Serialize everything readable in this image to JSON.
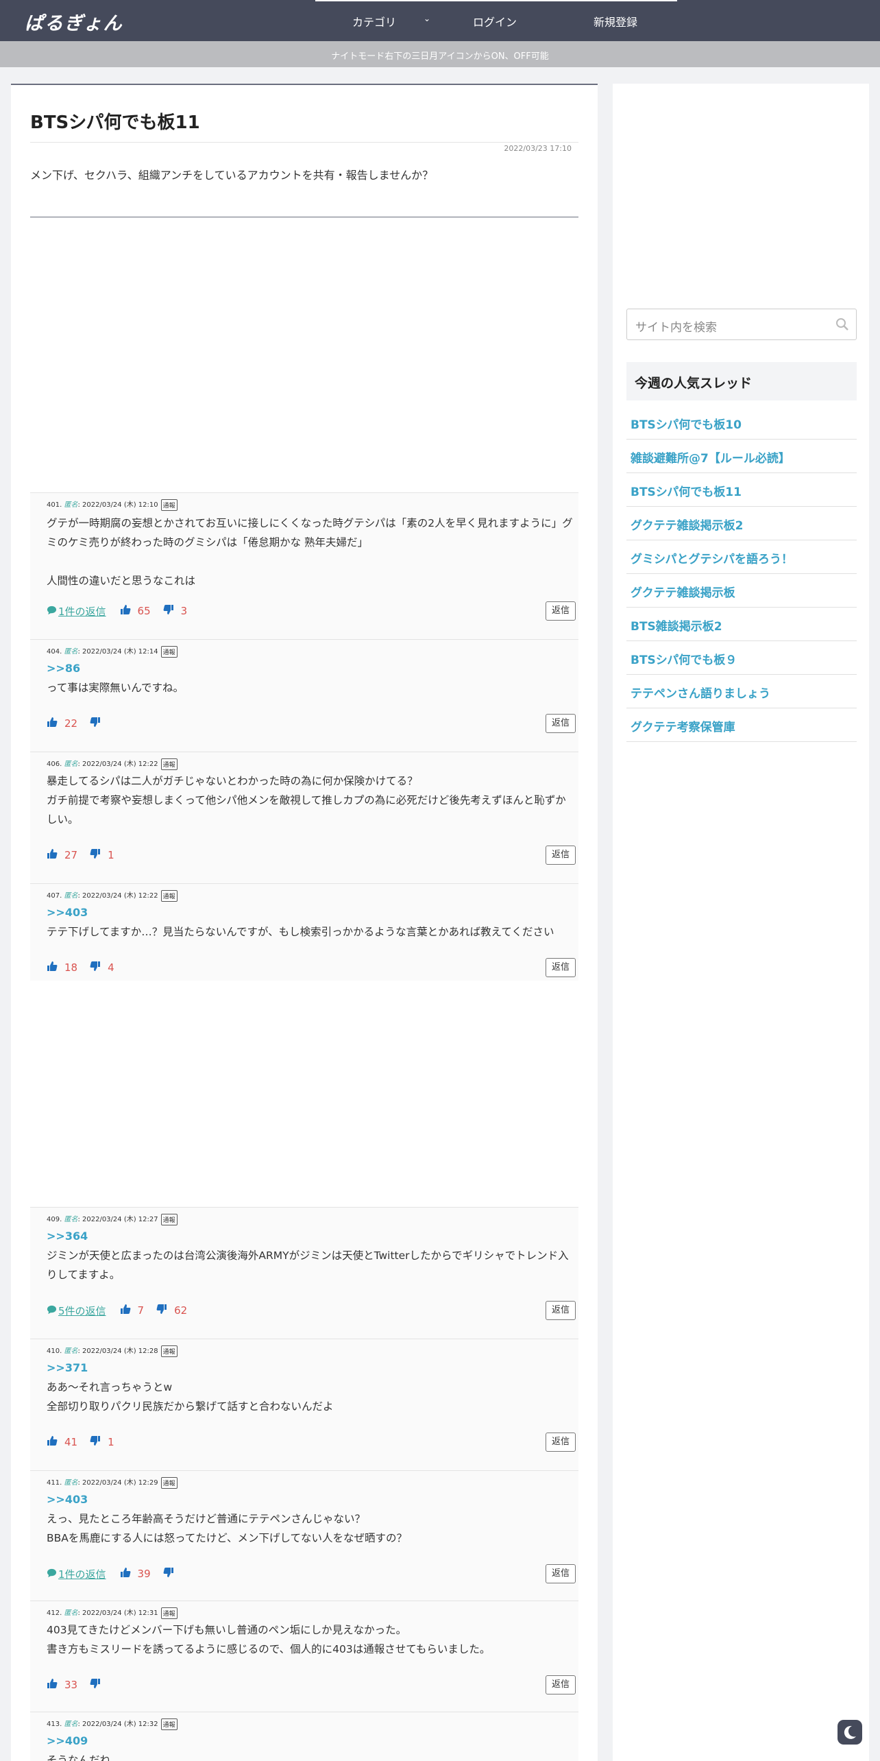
{
  "header": {
    "logo": "ぱるぎょん",
    "nav": {
      "category": "カテゴリ",
      "login": "ログイン",
      "register": "新規登録"
    }
  },
  "notice": "ナイトモード右下の三日月アイコンからON、OFF可能",
  "thread": {
    "title": "BTSシパ何でも板11",
    "date": "2022/03/23 17:10",
    "description": "メン下げ、セクハラ、組織アンチをしているアカウントを共有・報告しませんか？"
  },
  "labels": {
    "anon": "匿名",
    "report": "通報",
    "reply": "返信"
  },
  "posts": [
    {
      "num": "401.",
      "time": ": 2022/03/24 (木) 12:10",
      "ref": "",
      "body": [
        "グテが一時期腐の妄想とかされてお互いに接しにくくなった時グテシパは「素の2人を早く見れますように」グミのケミ売りが終わった時のグミシパは「倦怠期かな 熟年夫婦だ」",
        "",
        "人間性の違いだと思うなこれは"
      ],
      "replies": "1件の返信",
      "likes": "65",
      "dislikes": "3"
    },
    {
      "num": "404.",
      "time": ": 2022/03/24 (木) 12:14",
      "ref": ">>86",
      "body": [
        "って事は実際無いんですね。"
      ],
      "replies": "",
      "likes": "22",
      "dislikes": ""
    },
    {
      "num": "406.",
      "time": ": 2022/03/24 (木) 12:22",
      "ref": "",
      "body": [
        "暴走してるシパは二人がガチじゃないとわかった時の為に何か保険かけてる？",
        "ガチ前提で考察や妄想しまくって他シパ他メンを敵視して推しカプの為に必死だけど後先考えずほんと恥ずかしい。"
      ],
      "replies": "",
      "likes": "27",
      "dislikes": "1"
    },
    {
      "num": "407.",
      "time": ": 2022/03/24 (木) 12:22",
      "ref": ">>403",
      "body": [
        "テテ下げしてますか…？見当たらないんですが、もし検索引っかかるような言葉とかあれば教えてください"
      ],
      "replies": "",
      "likes": "18",
      "dislikes": "4"
    },
    {
      "num": "409.",
      "time": ": 2022/03/24 (木) 12:27",
      "ref": ">>364",
      "body": [
        "ジミンが天使と広まったのは台湾公演後海外ARMYがジミンは天使とTwitterしたからでギリシャでトレンド入りしてますよ。"
      ],
      "replies": "5件の返信",
      "likes": "7",
      "dislikes": "62"
    },
    {
      "num": "410.",
      "time": ": 2022/03/24 (木) 12:28",
      "ref": ">>371",
      "body": [
        "ああ〜それ言っちゃうとw",
        "全部切り取りパクリ民族だから繋げて話すと合わないんだよ"
      ],
      "replies": "",
      "likes": "41",
      "dislikes": "1"
    },
    {
      "num": "411.",
      "time": ": 2022/03/24 (木) 12:29",
      "ref": ">>403",
      "body": [
        "えっ、見たところ年齢高そうだけど普通にテテペンさんじゃない？",
        "BBAを馬鹿にする人には怒ってたけど、メン下げしてない人をなぜ晒すの？"
      ],
      "replies": "1件の返信",
      "likes": "39",
      "dislikes": ""
    },
    {
      "num": "412.",
      "time": ": 2022/03/24 (木) 12:31",
      "ref": "",
      "body": [
        "403見てきたけどメンバー下げも無いし普通のペン垢にしか見えなかった。",
        "書き方もミスリードを誘ってるように感じるので、個人的に403は通報させてもらいました。"
      ],
      "replies": "",
      "likes": "33",
      "dislikes": ""
    },
    {
      "num": "413.",
      "time": ": 2022/03/24 (木) 12:32",
      "ref": ">>409",
      "body": [
        "そうなんだね"
      ],
      "replies": "",
      "likes": "",
      "dislikes": ""
    }
  ],
  "sidebar": {
    "search_placeholder": "サイト内を検索",
    "popular_title": "今週の人気スレッド",
    "popular": [
      "BTSシパ何でも板10",
      "雑談避難所@7【ルール必読】",
      "BTSシパ何でも板11",
      "グクテテ雑談掲示板2",
      "グミシパとグテシパを語ろう！",
      "グクテテ雑談掲示板",
      "BTS雑談掲示板2",
      "BTSシパ何でも板９",
      "テテペンさん語りましょう",
      "グクテテ考察保管庫"
    ]
  },
  "colors": {
    "header": "#454a5b",
    "accent": "#3aa2c7",
    "anon": "#3ba79f",
    "count": "#d9534f",
    "icon": "#1f6fbf"
  }
}
